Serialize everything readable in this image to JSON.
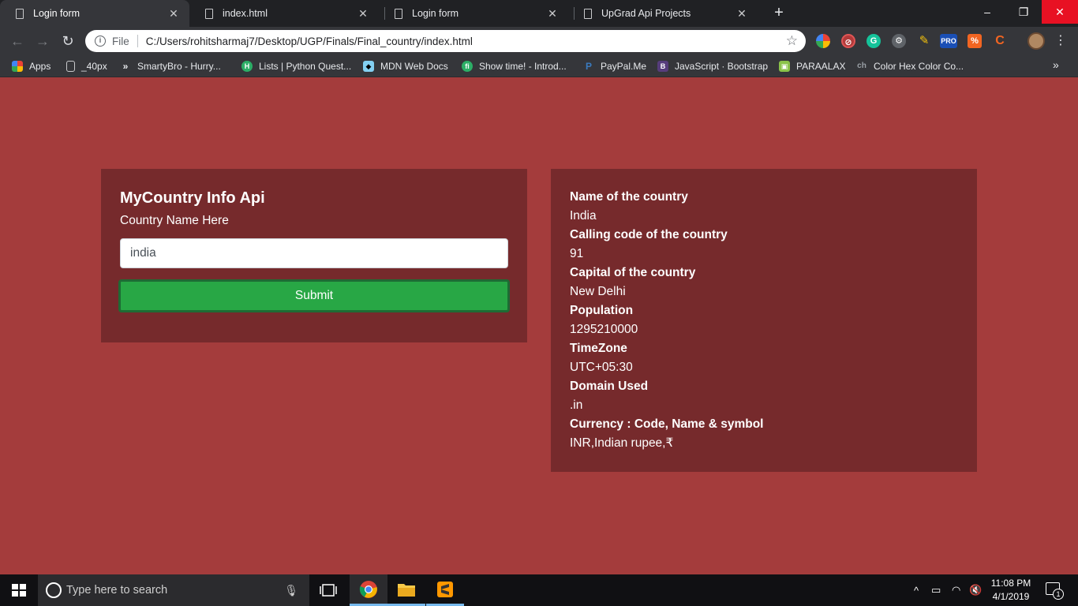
{
  "browser": {
    "tabs": [
      {
        "title": "Login form",
        "active": true
      },
      {
        "title": "index.html",
        "active": false
      },
      {
        "title": "Login form",
        "active": false
      },
      {
        "title": "UpGrad Api Projects",
        "active": false
      }
    ],
    "new_tab_glyph": "+",
    "window_controls": {
      "minimize": "–",
      "restore": "❐",
      "close": "✕"
    },
    "address_bar": {
      "scheme": "File",
      "url": "C:/Users/rohitsharmaj7/Desktop/UGP/Finals/Final_country/index.html"
    },
    "bookmarks": [
      {
        "label": "Apps",
        "icon": "apps-grid-icon"
      },
      {
        "label": "_40px",
        "icon": "page-icon"
      },
      {
        "label": "SmartyBro - Hurry...",
        "icon": "smartybro-icon"
      },
      {
        "label": "Lists | Python Quest...",
        "icon": "h-icon"
      },
      {
        "label": "MDN Web Docs",
        "icon": "mdn-icon"
      },
      {
        "label": "Show time! - Introd...",
        "icon": "fi-icon"
      },
      {
        "label": "PayPal.Me",
        "icon": "paypal-icon"
      },
      {
        "label": "JavaScript · Bootstrap",
        "icon": "bootstrap-icon"
      },
      {
        "label": "PARAALAX",
        "icon": "paraalax-icon"
      },
      {
        "label": "Color Hex Color Co...",
        "icon": "colorhex-icon"
      }
    ],
    "extension_pro_label": "PRO"
  },
  "page": {
    "form": {
      "title": "MyCountry Info Api",
      "label": "Country Name Here",
      "input_value": "india",
      "submit_label": "Submit"
    },
    "results": [
      {
        "label": "Name of the country",
        "value": "India"
      },
      {
        "label": "Calling code of the country",
        "value": "91"
      },
      {
        "label": "Capital of the country",
        "value": "New Delhi"
      },
      {
        "label": "Population",
        "value": "1295210000"
      },
      {
        "label": "TimeZone",
        "value": "UTC+05:30"
      },
      {
        "label": "Domain Used",
        "value": ".in"
      },
      {
        "label": "Currency : Code, Name & symbol",
        "value": "INR,Indian rupee,₹"
      }
    ]
  },
  "taskbar": {
    "search_placeholder": "Type here to search",
    "time": "11:08 PM",
    "date": "4/1/2019",
    "notification_count": "1"
  },
  "colors": {
    "page_background": "#a43c3c",
    "card_background": "#762a2c",
    "submit_button": "#28a745"
  }
}
